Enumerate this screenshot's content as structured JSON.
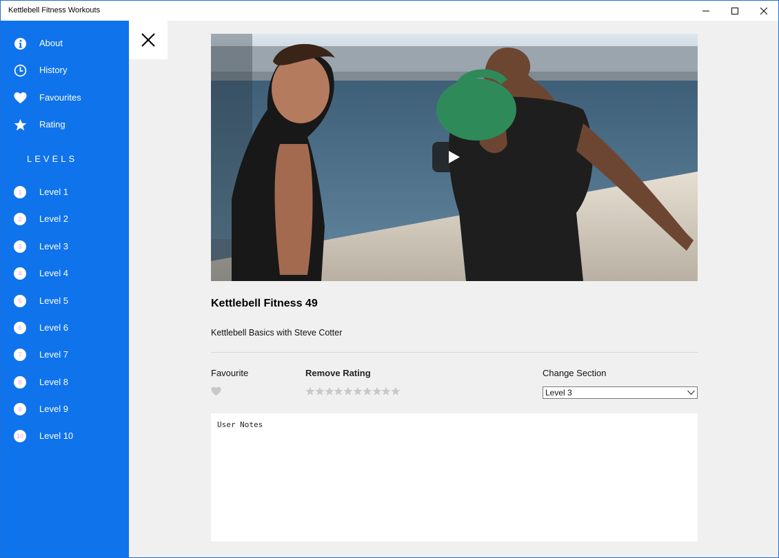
{
  "window": {
    "title": "Kettlebell Fitness Workouts"
  },
  "sidebar": {
    "menu": [
      {
        "label": "About",
        "icon": "info-icon"
      },
      {
        "label": "History",
        "icon": "clock-icon"
      },
      {
        "label": "Favourites",
        "icon": "heart-icon"
      },
      {
        "label": "Rating",
        "icon": "star-icon"
      }
    ],
    "levels_heading": "LEVELS",
    "levels": [
      {
        "num": "1",
        "label": "Level 1"
      },
      {
        "num": "2",
        "label": "Level 2"
      },
      {
        "num": "3",
        "label": "Level 3"
      },
      {
        "num": "4",
        "label": "Level 4"
      },
      {
        "num": "5",
        "label": "Level 5"
      },
      {
        "num": "6",
        "label": "Level 6"
      },
      {
        "num": "7",
        "label": "Level 7"
      },
      {
        "num": "8",
        "label": "Level 8"
      },
      {
        "num": "9",
        "label": "Level 9"
      },
      {
        "num": "10",
        "label": "Level 10"
      }
    ]
  },
  "workout": {
    "title": "Kettlebell Fitness 49",
    "subtitle": "Kettlebell Basics with Steve Cotter"
  },
  "controls": {
    "favourite_label": "Favourite",
    "rating_label": "Remove Rating",
    "rating_value": 0,
    "rating_max": 10,
    "section_label": "Change Section",
    "section_value": "Level 3"
  },
  "notes": {
    "placeholder": "User Notes",
    "value": ""
  },
  "colors": {
    "sidebar": "#0f73ec",
    "background": "#f0f0f0",
    "star_empty": "#c8c8c8"
  }
}
